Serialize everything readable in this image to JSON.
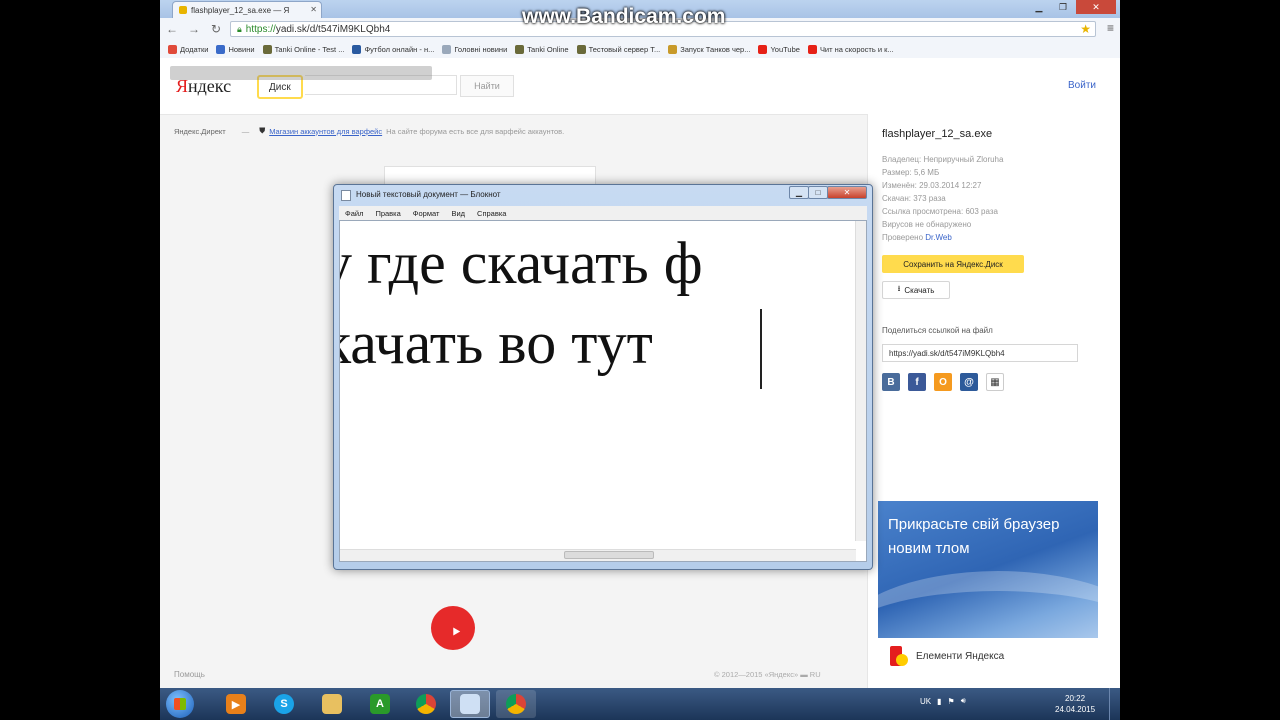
{
  "watermark": "www.Bandicam.com",
  "browser": {
    "tab_title": "flashplayer_12_sa.exe — Я",
    "url_scheme": "https://",
    "url_rest": "yadi.sk/d/t547iM9KLQbh4",
    "bookmarks": [
      {
        "label": "Додатки",
        "color": "#e04a3a"
      },
      {
        "label": "Новини",
        "color": "#3a6bc9"
      },
      {
        "label": "Tanki Online - Test ...",
        "color": "#6a6a3a"
      },
      {
        "label": "Футбол онлайн - н...",
        "color": "#2a5aa0"
      },
      {
        "label": "Головні новини",
        "color": "#9aa8ba"
      },
      {
        "label": "Tanki Online",
        "color": "#6a6a3a"
      },
      {
        "label": "Тестовый сервер Т...",
        "color": "#6a6a3a"
      },
      {
        "label": "Запуск Танков чер...",
        "color": "#c89a2a"
      },
      {
        "label": "YouTube",
        "color": "#e62117"
      },
      {
        "label": "Чит на скорость и к...",
        "color": "#e62117"
      }
    ]
  },
  "yandex": {
    "logo_first": "Я",
    "logo_rest": "ндекс",
    "service": "Диск",
    "find_label": "Найти",
    "login_label": "Войти",
    "direct_label": "Яндекс.Директ",
    "ad_link": "Магазин аккаунтов для варфейс",
    "ad_text": "На сайте форума есть все для варфейс аккаунтов.",
    "help_label": "Помощь",
    "copyright": "© 2012—2015 «Яндекс» ▬ RU"
  },
  "file": {
    "name": "flashplayer_12_sa.exe",
    "owner_label": "Владелец:",
    "owner": "Неприручный Zloruha",
    "size_label": "Размер:",
    "size": "5,6 МБ",
    "modified_label": "Изменён:",
    "modified": "29.03.2014 12:27",
    "downloads_label": "Скачан:",
    "downloads": "373 раза",
    "views_label": "Ссылка просмотрена:",
    "views": "603 раза",
    "virus_label": "Вирусов не обнаружено",
    "checked_label": "Проверено",
    "checked_by": "Dr.Web",
    "save_label": "Сохранить на Яндекс.Диск",
    "download_label": "Скачать",
    "share_label": "Поделиться ссылкой на файл",
    "share_url": "https://yadi.sk/d/t547iM9KLQbh4"
  },
  "banner": {
    "text": "Прикрасьте свій браузер новим тлом",
    "footer": "Елементи Яндекса"
  },
  "notepad": {
    "title": "Новый текстовый документ — Блокнот",
    "menu": [
      "Файл",
      "Правка",
      "Формат",
      "Вид",
      "Справка"
    ],
    "line1": "у где скачать ф",
    "line2": "качать во тут"
  },
  "taskbar": {
    "lang": "UK",
    "time": "20:22",
    "date": "24.04.2015"
  }
}
